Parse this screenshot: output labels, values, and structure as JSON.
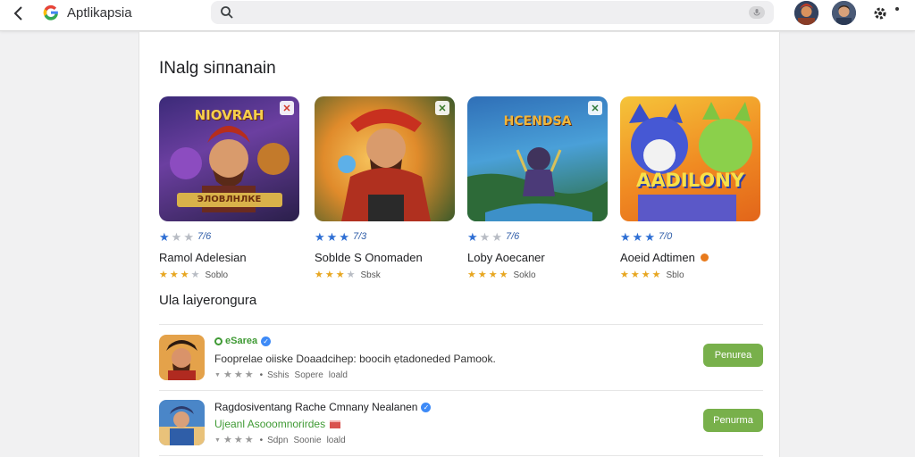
{
  "header": {
    "app_title": "Aptlikapsia",
    "search_placeholder": ""
  },
  "sections": {
    "featured_title": "INalg siпnanain",
    "list_title": "Ula laiyerongura"
  },
  "featured_apps": [
    {
      "thumb_title": "NIOVRAH",
      "thumb_sub": "ЭЛОВЛНЛКЕ",
      "rating": "7/6",
      "name": "Ramol Adelesian",
      "sub": "Soblo"
    },
    {
      "thumb_title": "",
      "thumb_sub": "",
      "rating": "7/3",
      "name": "Soblde S Onomaden",
      "sub": "Sbsk"
    },
    {
      "thumb_title": "HCENDSA",
      "thumb_sub": "",
      "rating": "7/6",
      "name": "Loby Aoecaner",
      "sub": "Soklo"
    },
    {
      "thumb_title": "AADILONY",
      "thumb_sub": "",
      "rating": "7/0",
      "name": "Aoeid Adtimen",
      "sub": "Sblo"
    }
  ],
  "list_apps": [
    {
      "title": "eSarea",
      "description": "Fooprelae oiiske Doaadcihep: boocih ẹtadoneded Pamook.",
      "meta_1": "Sshis",
      "meta_2": "Sopere",
      "meta_3": "loald",
      "button": "Penurea"
    },
    {
      "title": "Ragdosiventang Rache Cmnany Nealanen",
      "subtitle": "Ujeanl Asooomnorirdes",
      "meta_1": "Sdpn",
      "meta_2": "Soonie",
      "meta_3": "loald",
      "button": "Penurma"
    }
  ],
  "colors": {
    "accent_green": "#78b04b",
    "star_blue": "#2f6fd4",
    "star_gold": "#e7a620"
  }
}
